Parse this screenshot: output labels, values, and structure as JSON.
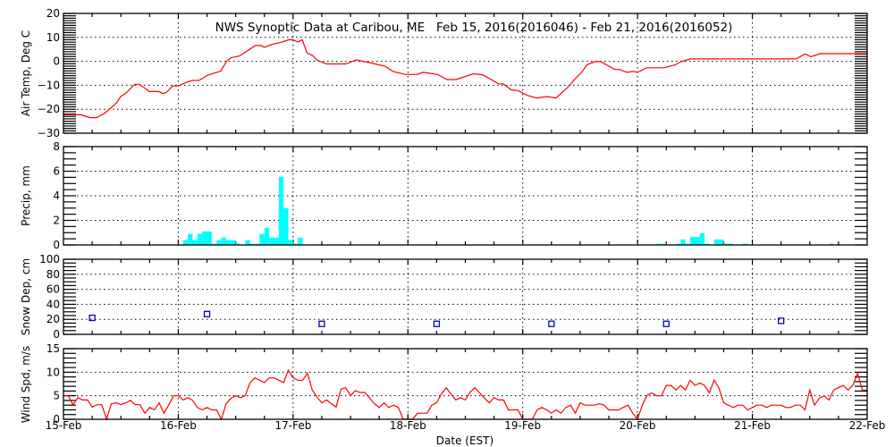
{
  "chart_data": {
    "type": "line",
    "title": "NWS Synoptic Data at Caribou, ME   Feb 15, 2016(2016046) - Feb 21, 2016(2016052)",
    "xlabel": "Date (EST)",
    "x_ticks": [
      "15-Feb",
      "16-Feb",
      "17-Feb",
      "18-Feb",
      "19-Feb",
      "20-Feb",
      "21-Feb",
      "22-Feb"
    ],
    "x_range_days": [
      0,
      7
    ],
    "grid": true,
    "colors": {
      "line": "#ff0000",
      "precip": "#00ffff",
      "snow": "#0000cc",
      "axis": "#000000"
    },
    "panels": [
      {
        "name": "air-temp",
        "type": "line",
        "ylabel": "Air Temp, Deg C",
        "ylim": [
          -30,
          20
        ],
        "y_ticks": [
          20,
          10,
          0,
          -10,
          -20,
          -30
        ],
        "x_unit": "days since 15-Feb 00:00",
        "points": [
          [
            0,
            -22.3
          ],
          [
            0.15,
            -22.3
          ],
          [
            0.23,
            -23.5
          ],
          [
            0.29,
            -23.5
          ],
          [
            0.36,
            -21.6
          ],
          [
            0.46,
            -17.5
          ],
          [
            0.5,
            -14.6
          ],
          [
            0.54,
            -13.4
          ],
          [
            0.62,
            -9.6
          ],
          [
            0.66,
            -9.6
          ],
          [
            0.75,
            -12.6
          ],
          [
            0.83,
            -12.6
          ],
          [
            0.87,
            -13.5
          ],
          [
            0.9,
            -12.8
          ],
          [
            0.95,
            -10.3
          ],
          [
            1.0,
            -10.3
          ],
          [
            1.06,
            -9
          ],
          [
            1.12,
            -8
          ],
          [
            1.18,
            -8
          ],
          [
            1.26,
            -5.7
          ],
          [
            1.37,
            -4.1
          ],
          [
            1.42,
            0
          ],
          [
            1.46,
            1.5
          ],
          [
            1.53,
            2.2
          ],
          [
            1.59,
            4
          ],
          [
            1.67,
            6.6
          ],
          [
            1.72,
            6.6
          ],
          [
            1.75,
            5.9
          ],
          [
            1.81,
            7
          ],
          [
            1.9,
            8
          ],
          [
            1.96,
            9
          ],
          [
            2.0,
            9
          ],
          [
            2.04,
            8.1
          ],
          [
            2.08,
            9
          ],
          [
            2.12,
            3.6
          ],
          [
            2.17,
            2.4
          ],
          [
            2.21,
            0.5
          ],
          [
            2.29,
            -1.1
          ],
          [
            2.46,
            -1.1
          ],
          [
            2.55,
            0.6
          ],
          [
            2.68,
            -0.7
          ],
          [
            2.8,
            -2
          ],
          [
            2.87,
            -4.2
          ],
          [
            2.98,
            -5.5
          ],
          [
            3.08,
            -5.5
          ],
          [
            3.13,
            -4.6
          ],
          [
            3.26,
            -5.5
          ],
          [
            3.34,
            -7.6
          ],
          [
            3.42,
            -7.6
          ],
          [
            3.57,
            -5.2
          ],
          [
            3.65,
            -5.6
          ],
          [
            3.79,
            -9.4
          ],
          [
            3.83,
            -9.4
          ],
          [
            3.9,
            -11.9
          ],
          [
            3.96,
            -12.2
          ],
          [
            4.04,
            -14.2
          ],
          [
            4.12,
            -15.3
          ],
          [
            4.21,
            -14.7
          ],
          [
            4.29,
            -15.3
          ],
          [
            4.41,
            -10
          ],
          [
            4.45,
            -7.6
          ],
          [
            4.52,
            -4.2
          ],
          [
            4.56,
            -1.4
          ],
          [
            4.63,
            -0.1
          ],
          [
            4.68,
            -0.1
          ],
          [
            4.8,
            -3.4
          ],
          [
            4.84,
            -3.4
          ],
          [
            4.91,
            -4.6
          ],
          [
            4.96,
            -4.2
          ],
          [
            5.0,
            -4.6
          ],
          [
            5.08,
            -2.7
          ],
          [
            5.23,
            -2.7
          ],
          [
            5.33,
            -1.4
          ],
          [
            5.38,
            -0.1
          ],
          [
            5.46,
            1
          ],
          [
            6.38,
            1
          ],
          [
            6.46,
            3.1
          ],
          [
            6.51,
            1.9
          ],
          [
            6.59,
            3.2
          ],
          [
            7.0,
            3.2
          ]
        ]
      },
      {
        "name": "precip",
        "type": "bar",
        "ylabel": "Precip, mm",
        "ylim": [
          0,
          8
        ],
        "y_ticks": [
          8,
          6,
          4,
          2,
          0
        ],
        "x_unit": "hour since 15-Feb 00:00",
        "bars": [
          [
            25,
            0.4
          ],
          [
            26,
            0.9
          ],
          [
            27,
            0.4
          ],
          [
            28,
            0.9
          ],
          [
            29,
            1.1
          ],
          [
            30,
            1.1
          ],
          [
            31,
            0.1
          ],
          [
            32,
            0.4
          ],
          [
            33,
            0.6
          ],
          [
            34,
            0.4
          ],
          [
            35,
            0.4
          ],
          [
            36,
            0.1
          ],
          [
            38,
            0.4
          ],
          [
            39,
            0.1
          ],
          [
            40,
            0.1
          ],
          [
            41,
            0.9
          ],
          [
            42,
            1.4
          ],
          [
            43,
            0.6
          ],
          [
            44,
            0.6
          ],
          [
            45,
            5.55
          ],
          [
            46,
            3.0
          ],
          [
            47,
            0.4
          ],
          [
            48,
            0.1
          ],
          [
            49,
            0.6
          ],
          [
            124,
            0.1
          ],
          [
            125,
            0.1
          ],
          [
            128,
            0.1
          ],
          [
            129,
            0.45
          ],
          [
            130,
            0.1
          ],
          [
            131,
            0.65
          ],
          [
            132,
            0.65
          ],
          [
            133,
            0.95
          ],
          [
            134,
            0.1
          ],
          [
            136,
            0.45
          ],
          [
            137,
            0.45
          ],
          [
            138,
            0.1
          ],
          [
            139,
            0.1
          ],
          [
            142,
            0.1
          ],
          [
            160,
            0.1
          ]
        ]
      },
      {
        "name": "snow-depth",
        "type": "scatter",
        "ylabel": "Snow Dep, cm",
        "ylim": [
          0,
          100
        ],
        "y_ticks": [
          100,
          80,
          60,
          40,
          20,
          0
        ],
        "x_unit": "days since 15-Feb 00:00",
        "points": [
          [
            0.25,
            22
          ],
          [
            1.25,
            27
          ],
          [
            2.25,
            14
          ],
          [
            3.25,
            14
          ],
          [
            4.25,
            14
          ],
          [
            5.25,
            14
          ],
          [
            6.25,
            18
          ]
        ]
      },
      {
        "name": "wind-speed",
        "type": "line",
        "ylabel": "Wind Spd, m/s",
        "ylim": [
          0,
          15
        ],
        "y_ticks": [
          15,
          10,
          5,
          0
        ],
        "x_unit": "hourly from 15-Feb 00:00",
        "values": [
          5,
          5,
          3.1,
          4.6,
          4.1,
          4.1,
          2.6,
          3.1,
          3.1,
          0,
          3.3,
          3.5,
          3.1,
          3.5,
          4.0,
          3.1,
          3.1,
          1.3,
          2.5,
          2.0,
          3.5,
          1.3,
          3.0,
          5.0,
          5.0,
          4.1,
          4.6,
          4.0,
          2.5,
          2.0,
          2.5,
          2.0,
          2.0,
          0,
          3.3,
          4.5,
          5.0,
          4.6,
          5.0,
          7.8,
          8.8,
          8.3,
          7.8,
          8.8,
          8.8,
          8.3,
          7.8,
          10.4,
          8.8,
          8.3,
          8.3,
          9.8,
          6.2,
          4.7,
          3.5,
          4.1,
          3.3,
          2.6,
          6.4,
          6.7,
          5.0,
          6.1,
          5.7,
          5.7,
          4.5,
          3.3,
          2.5,
          3.5,
          2.5,
          3.0,
          2.5,
          0,
          0,
          0,
          1.3,
          1.3,
          1.3,
          3.0,
          3.5,
          5.4,
          6.7,
          5.4,
          4.1,
          4.6,
          4.1,
          5.8,
          6.7,
          5.6,
          4.5,
          3.5,
          4.6,
          4.1,
          4.1,
          2.0,
          2.0,
          2.0,
          0,
          0,
          0,
          2.0,
          2.5,
          2.0,
          1.3,
          2.0,
          1.3,
          2.5,
          3.0,
          1.3,
          3.5,
          3.0,
          3.0,
          3.0,
          3.3,
          3.0,
          2.0,
          2.0,
          2.0,
          2.5,
          3.0,
          1.3,
          0,
          3.0,
          5.1,
          5.6,
          5.0,
          5.0,
          7.2,
          7.2,
          6.2,
          7.2,
          6.2,
          8.3,
          7.2,
          7.7,
          7.2,
          5.6,
          8.3,
          6.7,
          3.5,
          3.0,
          2.5,
          3.0,
          3.0,
          2.0,
          2.5,
          3.0,
          3.0,
          2.5,
          3.0,
          3.0,
          3.0,
          2.5,
          2.5,
          3.0,
          3.0,
          2.0,
          6.2,
          3.0,
          4.5,
          5.0,
          4.1,
          6.2,
          6.7,
          7.2,
          6.2,
          7.2,
          9.8,
          6.2,
          6.2
        ]
      }
    ]
  }
}
